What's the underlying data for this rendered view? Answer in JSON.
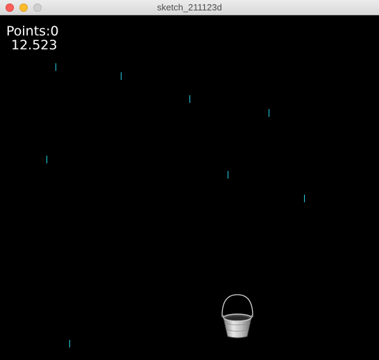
{
  "window": {
    "title": "sketch_211123d"
  },
  "hud": {
    "points_label": "Points:0",
    "timer": "12.523"
  },
  "colors": {
    "background": "#000000",
    "raindrop": "#27d3e6",
    "text": "#ffffff"
  },
  "icons": {
    "player": "bucket-icon",
    "falling_object": "raindrop-icon"
  }
}
